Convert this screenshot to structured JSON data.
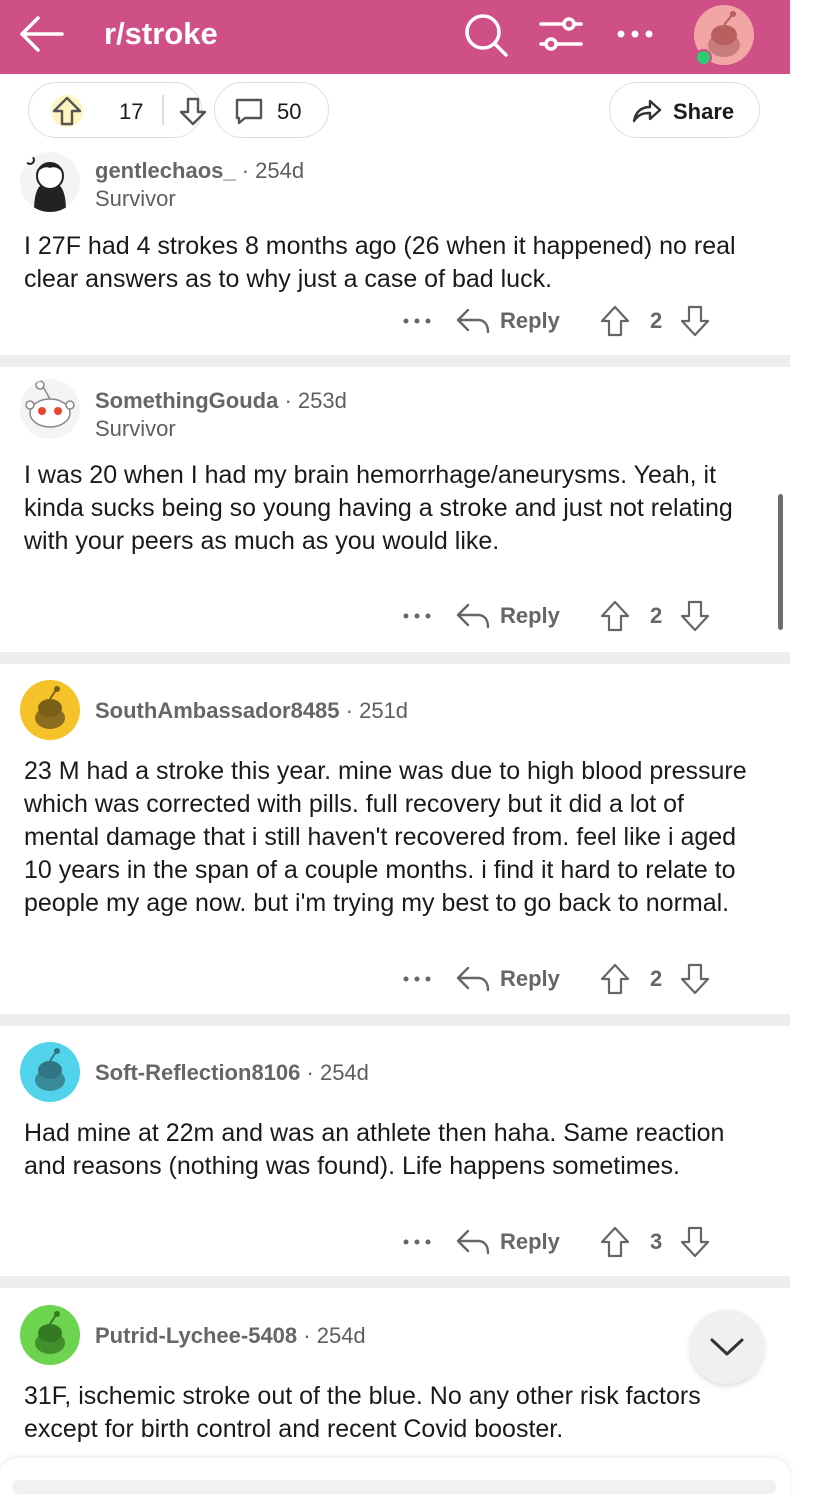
{
  "header": {
    "title": "r/stroke",
    "accent": "#cf4f87"
  },
  "post_actions": {
    "upvotes": "17",
    "comments": "50",
    "share_label": "Share"
  },
  "comments": [
    {
      "user": "gentlechaos_",
      "age": "254d",
      "flair": "Survivor",
      "body": "I 27F had 4 strokes 8 months ago (26 when it happened) no real clear answers as to why just a case of bad luck.",
      "reply_label": "Reply",
      "score": "2"
    },
    {
      "user": "SomethingGouda",
      "age": "253d",
      "flair": "Survivor",
      "body": "I was 20 when I had my brain hemorrhage/aneurysms. Yeah, it kinda sucks being so young having a stroke and just not relating with your peers as much as you would like.",
      "reply_label": "Reply",
      "score": "2"
    },
    {
      "user": "SouthAmbassador8485",
      "age": "251d",
      "body": "23 M had a stroke this year. mine was due to high blood pressure which was corrected with pills. full recovery but it did a lot of mental damage that i still haven't recovered from. feel like i aged 10 years in the span of a couple months. i find it hard to relate to people my age now. but i'm trying my best to go back to normal.",
      "reply_label": "Reply",
      "score": "2"
    },
    {
      "user": "Soft-Reflection8106",
      "age": "254d",
      "body": "Had mine at 22m and was an athlete then haha. Same reaction and reasons (nothing was found). Life happens sometimes.",
      "reply_label": "Reply",
      "score": "3"
    },
    {
      "user": "Putrid-Lychee-5408",
      "age": "254d",
      "body": "31F, ischemic stroke out of the blue. No any other risk factors except for birth control and recent Covid booster."
    }
  ]
}
